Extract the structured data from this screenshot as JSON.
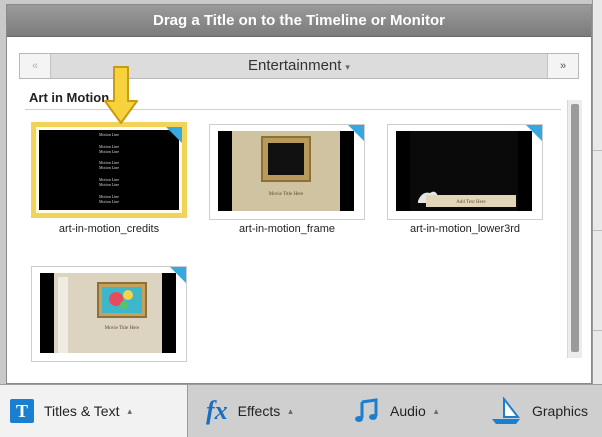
{
  "window": {
    "title": "Drag a Title on to the Timeline or Monitor"
  },
  "category_nav": {
    "prev_icon": "«",
    "next_icon": "»",
    "selected": "Entertainment",
    "caret": "▾"
  },
  "section": {
    "title": "Art in Motion"
  },
  "thumbnails": [
    {
      "label": "art-in-motion_credits",
      "selected": true
    },
    {
      "label": "art-in-motion_frame",
      "selected": false
    },
    {
      "label": "art-in-motion_lower3rd",
      "selected": false
    },
    {
      "label": "",
      "selected": false
    }
  ],
  "thumbnail_text": {
    "credits_lines": [
      "Motion Line",
      "Motion Line",
      "Motion Line",
      "Motion Line",
      "Motion Line",
      "Motion Line",
      "Motion Line",
      "Motion Line",
      "Motion Line"
    ],
    "frame_caption": "Movie Title Here",
    "lower3rd_caption": "Add Text Here",
    "fourth_caption": "Movie Title Here"
  },
  "tabs": [
    {
      "label": "Titles & Text",
      "icon": "T",
      "caret": "▴"
    },
    {
      "label": "Effects",
      "icon": "fx",
      "caret": "▴"
    },
    {
      "label": "Audio",
      "icon": "music-note",
      "caret": "▴"
    },
    {
      "label": "Graphics",
      "icon": "sailboat",
      "caret": ""
    }
  ],
  "colors": {
    "selection_border": "#f2d35a",
    "corner_badge": "#35a8e0",
    "accent_blue": "#1a7fd0"
  }
}
